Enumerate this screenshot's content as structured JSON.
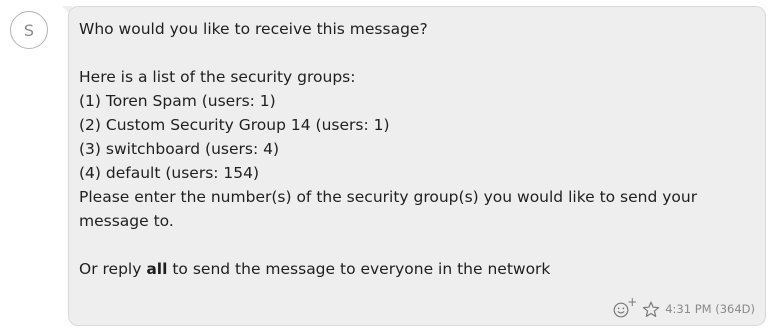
{
  "avatar": {
    "initial": "S"
  },
  "message": {
    "line1": "Who would you like to receive this message?",
    "line2": "Here is a list of the security groups:",
    "groups": [
      "(1) Toren Spam (users: 1)",
      "(2) Custom Security Group 14 (users: 1)",
      "(3) switchboard (users: 4)",
      "(4) default (users: 154)"
    ],
    "instruction": "Please enter the number(s) of the security group(s) you would like to send your message to.",
    "reply_prefix": "Or reply ",
    "reply_keyword": "all",
    "reply_suffix": " to send the message to everyone in the network"
  },
  "meta": {
    "timestamp": "4:31 PM (364D)",
    "react_icon": "emoji-add-icon",
    "star_icon": "star-icon"
  },
  "colors": {
    "bubble_bg": "#eeeeee",
    "text": "#1f1f1f",
    "meta": "#8a8a8a"
  }
}
